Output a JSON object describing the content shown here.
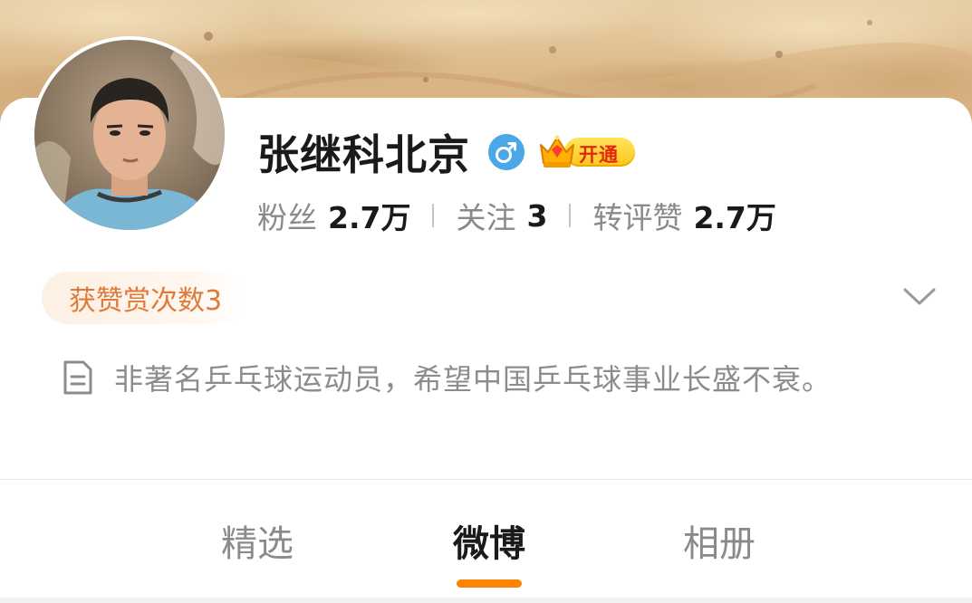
{
  "profile": {
    "name": "张继科北京",
    "vip_label": "开通"
  },
  "stats": {
    "fans_label": "粉丝",
    "fans_value": "2.7万",
    "follow_label": "关注",
    "follow_value": "3",
    "interactions_label": "转评赞",
    "interactions_value": "2.7万"
  },
  "reward": {
    "label": "获赞赏次数3"
  },
  "bio": {
    "text": "非著名乒乓球运动员，希望中国乒乓球事业长盛不衰。"
  },
  "tabs": [
    {
      "label": "精选",
      "active": false
    },
    {
      "label": "微博",
      "active": true
    },
    {
      "label": "相册",
      "active": false
    }
  ],
  "colors": {
    "accent": "#ff8200",
    "reward_text": "#e07a3a",
    "gender_blue": "#4aa8e8",
    "vip_gold": "#ffc61a"
  },
  "icons": {
    "gender": "male-gender-icon",
    "vip": "crown-icon",
    "expand": "chevron-down-icon",
    "bio": "document-icon"
  }
}
